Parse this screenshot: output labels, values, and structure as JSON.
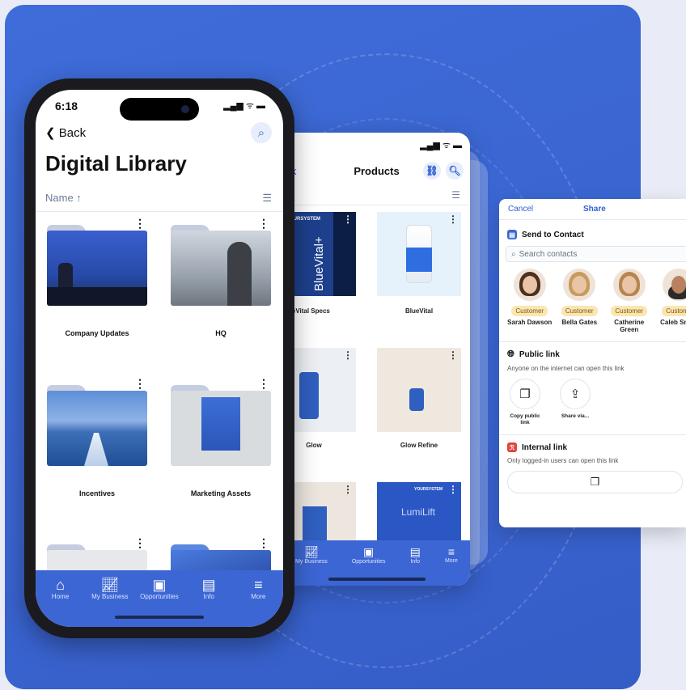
{
  "main_phone": {
    "status_time": "6:18",
    "status_icons": "▂▄▆ ᯤ ▬",
    "back_label": "Back",
    "title": "Digital Library",
    "sort_label": "Name ↑",
    "folders": [
      {
        "label": "Company Updates"
      },
      {
        "label": "HQ"
      },
      {
        "label": "Incentives"
      },
      {
        "label": "Marketing Assets"
      }
    ],
    "tabbar": [
      {
        "label": "Home",
        "icon": "home-icon"
      },
      {
        "label": "My Business",
        "icon": "chart-icon"
      },
      {
        "label": "Opportunities",
        "icon": "badge-icon"
      },
      {
        "label": "Info",
        "icon": "book-icon"
      },
      {
        "label": "More",
        "icon": "menu-icon"
      }
    ]
  },
  "products_phone": {
    "back_fragment": "k",
    "title": "Products",
    "products": [
      {
        "label": "ueVital Specs",
        "brand": "YOURSYSTEM",
        "product": "BlueVital+"
      },
      {
        "label": "BlueVital"
      },
      {
        "label": "Glow"
      },
      {
        "label": "Glow Refine"
      }
    ],
    "lumlift_text": "LumiLift",
    "tabbar": [
      {
        "label": "My Business"
      },
      {
        "label": "Opportunities"
      },
      {
        "label": "Info"
      },
      {
        "label": "More"
      }
    ]
  },
  "share": {
    "cancel": "Cancel",
    "title": "Share",
    "send_to_contact": "Send to Contact",
    "search_placeholder": "Search contacts",
    "contacts": [
      {
        "badge": "Customer",
        "name": "Sarah Dawson"
      },
      {
        "badge": "Customer",
        "name": "Bella Gates"
      },
      {
        "badge": "Customer",
        "name": "Catherine Green"
      },
      {
        "badge": "Custome",
        "name": "Caleb Smith"
      }
    ],
    "public_link_title": "Public link",
    "public_link_desc": "Anyone on the internet can open this link",
    "copy_public_link": "Copy public link",
    "share_via": "Share via...",
    "internal_link_title": "Internal link",
    "internal_link_desc": "Only logged-in users can open this link"
  },
  "colors": {
    "accent": "#2f5fd5",
    "tabbar": "#3c66d4",
    "background": "#3a64d0",
    "badge": "#fbe6b2"
  }
}
